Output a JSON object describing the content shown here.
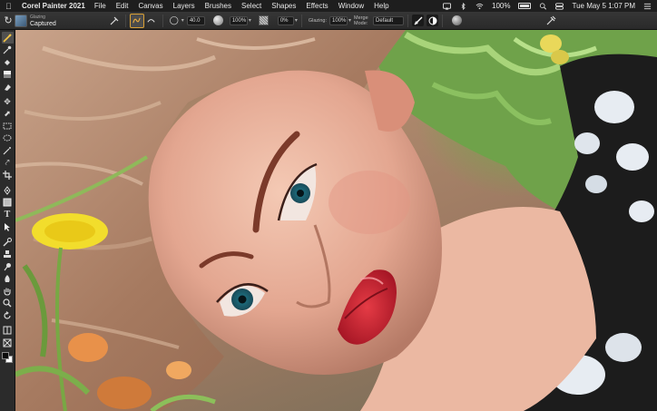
{
  "menubar": {
    "app_name": "Corel Painter 2021",
    "menus": [
      "File",
      "Edit",
      "Canvas",
      "Layers",
      "Brushes",
      "Select",
      "Shapes",
      "Effects",
      "Window",
      "Help"
    ],
    "battery": "100%",
    "clock": "Tue May 5  1:07 PM"
  },
  "propbar": {
    "brush_category": "Glazing",
    "brush_variant": "Captured",
    "size_value": "40.0",
    "opacity_value": "100%",
    "angle_value": "0%",
    "glazing_label": "Glazing:",
    "glazing_value": "100%",
    "merge_mode_label": "Merge Mode:",
    "merge_mode_value": "Default"
  },
  "toolbox": {
    "tools": [
      "brush-tool",
      "dropper-tool",
      "paint-bucket-tool",
      "eraser-tool",
      "transform-tool",
      "layer-adjuster-tool",
      "rectangular-selection-tool",
      "lasso-tool",
      "magic-wand-tool",
      "crop-tool",
      "pen-tool",
      "shape-tool",
      "text-tool",
      "shape-selection-tool",
      "cloner-tool",
      "rubber-stamp-tool",
      "dodge-tool",
      "burn-tool",
      "grabber-tool",
      "magnifier-tool",
      "rotate-page-tool",
      "mirror-tool",
      "kaleidoscope-tool"
    ],
    "main_color": "#0c0c0c",
    "additional_color": "#ffffff"
  }
}
